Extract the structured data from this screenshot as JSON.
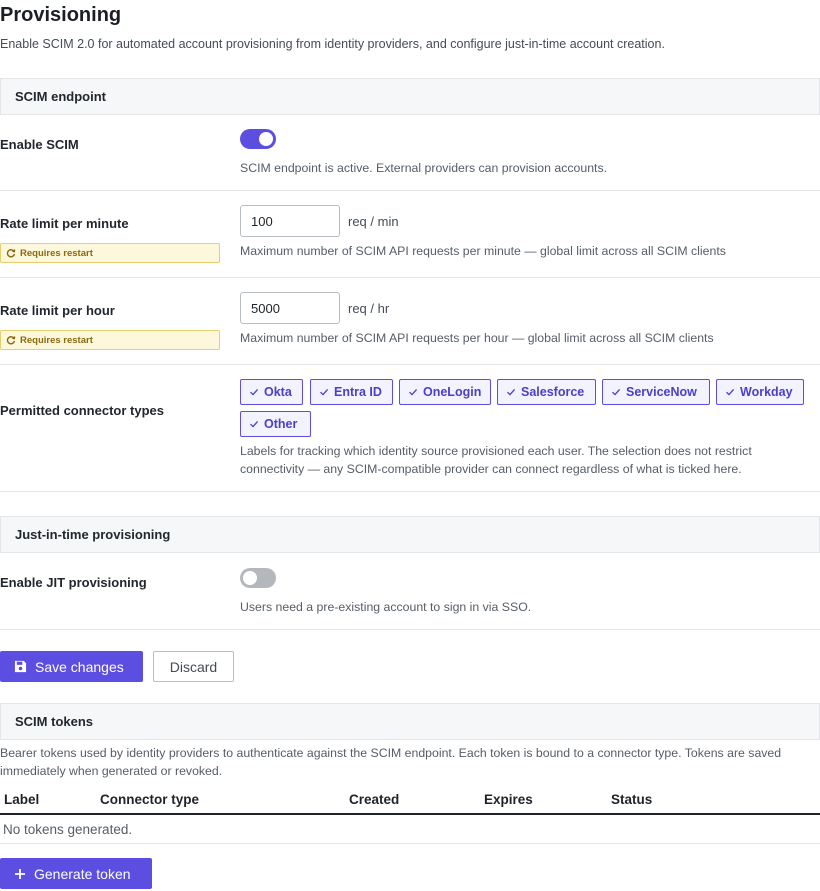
{
  "page": {
    "title": "Provisioning",
    "description": "Enable SCIM 2.0 for automated account provisioning from identity providers, and configure just-in-time account creation."
  },
  "scim_section": {
    "header": "SCIM endpoint",
    "enable": {
      "label": "Enable SCIM",
      "enabled": true,
      "help": "SCIM endpoint is active. External providers can provision accounts."
    },
    "rate_minute": {
      "label": "Rate limit per minute",
      "badge": "Requires restart",
      "value": "100",
      "unit": "req / min",
      "help": "Maximum number of SCIM API requests per minute — global limit across all SCIM clients"
    },
    "rate_hour": {
      "label": "Rate limit per hour",
      "badge": "Requires restart",
      "value": "5000",
      "unit": "req / hr",
      "help": "Maximum number of SCIM API requests per hour — global limit across all SCIM clients"
    },
    "connectors": {
      "label": "Permitted connector types",
      "chips": [
        "Okta",
        "Entra ID",
        "OneLogin",
        "Salesforce",
        "ServiceNow",
        "Workday",
        "Other"
      ],
      "help_line1": "Labels for tracking which identity source provisioned each user. The selection does not restrict",
      "help_line2": "connectivity — any SCIM-compatible provider can connect regardless of what is ticked here."
    }
  },
  "jit_section": {
    "header": "Just-in-time provisioning",
    "enable": {
      "label": "Enable JIT provisioning",
      "enabled": false,
      "help": "Users need a pre-existing account to sign in via SSO."
    }
  },
  "actions": {
    "save_label": "Save changes",
    "discard_label": "Discard"
  },
  "tokens_section": {
    "header": "SCIM tokens",
    "description_line1": "Bearer tokens used by identity providers to authenticate against the SCIM endpoint. Each token is bound to a connector type. Tokens are saved",
    "description_line2": "immediately when generated or revoked.",
    "columns": [
      "Label",
      "Connector type",
      "Created",
      "Expires",
      "Status"
    ],
    "empty_text": "No tokens generated.",
    "generate_label": "Generate token"
  },
  "colors": {
    "accent": "#5b4ee0",
    "badge_bg": "#fdf7dc",
    "badge_text": "#8a6a10"
  }
}
